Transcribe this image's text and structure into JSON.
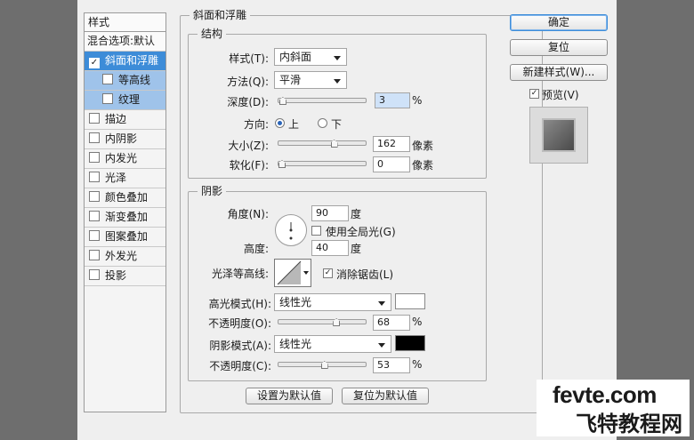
{
  "styles_panel": {
    "header": "样式",
    "items": [
      {
        "label": "混合选项:默认",
        "checkbox": false
      },
      {
        "label": "斜面和浮雕",
        "checkbox": true,
        "checked": true
      },
      {
        "label": "等高线",
        "checkbox": true,
        "checked": false
      },
      {
        "label": "纹理",
        "checkbox": true,
        "checked": false
      },
      {
        "label": "描边",
        "checkbox": true,
        "checked": false
      },
      {
        "label": "内阴影",
        "checkbox": true,
        "checked": false
      },
      {
        "label": "内发光",
        "checkbox": true,
        "checked": false
      },
      {
        "label": "光泽",
        "checkbox": true,
        "checked": false
      },
      {
        "label": "颜色叠加",
        "checkbox": true,
        "checked": false
      },
      {
        "label": "渐变叠加",
        "checkbox": true,
        "checked": false
      },
      {
        "label": "图案叠加",
        "checkbox": true,
        "checked": false
      },
      {
        "label": "外发光",
        "checkbox": true,
        "checked": false
      },
      {
        "label": "投影",
        "checkbox": true,
        "checked": false
      }
    ],
    "check_mark": "✓"
  },
  "bevel": {
    "title": "斜面和浮雕",
    "structure": {
      "title": "结构",
      "style_label": "样式(T):",
      "style_value": "内斜面",
      "technique_label": "方法(Q):",
      "technique_value": "平滑",
      "depth_label": "深度(D):",
      "depth_value": "3",
      "depth_unit": "%",
      "depth_level": 0.01,
      "direction_label": "方向:",
      "direction_up": "上",
      "direction_down": "下",
      "size_label": "大小(Z):",
      "size_value": "162",
      "size_unit": "像素",
      "size_level": 0.65,
      "soften_label": "软化(F):",
      "soften_value": "0",
      "soften_unit": "像素",
      "soften_level": 0.0
    },
    "shading": {
      "title": "阴影",
      "angle_label": "角度(N):",
      "angle_value": "90",
      "angle_unit": "度",
      "global_light_label": "使用全局光(G)",
      "altitude_label": "高度:",
      "altitude_value": "40",
      "altitude_unit": "度",
      "gloss_contour_label": "光泽等高线:",
      "anti_alias_label": "消除锯齿(L)",
      "highlight_mode_label": "高光模式(H):",
      "highlight_mode_value": "线性光",
      "highlight_color": "#ffffff",
      "highlight_opacity_label": "不透明度(O):",
      "highlight_opacity_value": "68",
      "highlight_opacity_level": 0.68,
      "shadow_mode_label": "阴影模式(A):",
      "shadow_mode_value": "线性光",
      "shadow_color": "#000000",
      "shadow_opacity_label": "不透明度(C):",
      "shadow_opacity_value": "53",
      "shadow_opacity_level": 0.53,
      "percent": "%"
    },
    "make_default": "设置为默认值",
    "reset_default": "复位为默认值"
  },
  "actions": {
    "ok": "确定",
    "reset": "复位",
    "new_style": "新建样式(W)...",
    "preview_label": "预览(V)"
  },
  "watermark": {
    "line1": "fevte.com",
    "line2": "飞特教程网"
  }
}
